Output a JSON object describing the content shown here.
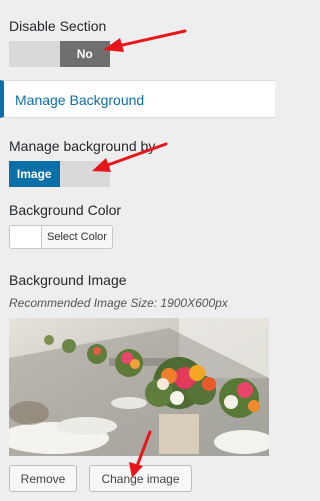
{
  "disable_section": {
    "label": "Disable Section",
    "on_label": "",
    "off_label": "No",
    "state": "off"
  },
  "section_header": {
    "title": "Manage Background"
  },
  "manage_by": {
    "label": "Manage background by",
    "selected": "Image",
    "other": ""
  },
  "background_color": {
    "label": "Background Color",
    "button_label": "Select Color",
    "value": "#ffffff"
  },
  "background_image": {
    "label": "Background Image",
    "note": "Recommended Image Size: 1900X600px",
    "remove_label": "Remove",
    "change_label": "Change image"
  },
  "colors": {
    "accent": "#0b6fa8",
    "toggle_dark": "#6f6f6f",
    "arrow": "#e8161b"
  }
}
